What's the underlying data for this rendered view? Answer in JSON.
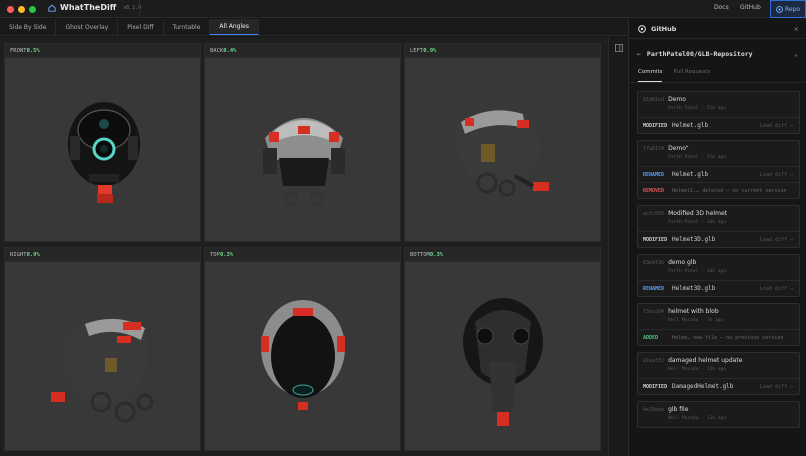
{
  "window": {
    "traffic_lights": [
      "#ff5f57",
      "#febc2e",
      "#28c840"
    ]
  },
  "app": {
    "title": "WhatTheDiff",
    "version": "v0.1.0"
  },
  "top_nav": {
    "docs": "Docs",
    "github": "GitHub",
    "repo_button": "Repo"
  },
  "view_tabs": [
    {
      "label": "Side By Side"
    },
    {
      "label": "Ghost Overlay"
    },
    {
      "label": "Pixel Diff"
    },
    {
      "label": "Turntable"
    },
    {
      "label": "All Angles",
      "active": true
    }
  ],
  "views": [
    {
      "label": "FRONT",
      "pct": "0.5%"
    },
    {
      "label": "BACK",
      "pct": "0.4%"
    },
    {
      "label": "LEFT",
      "pct": "0.9%"
    },
    {
      "label": "RIGHT",
      "pct": "0.9%"
    },
    {
      "label": "TOP",
      "pct": "0.3%"
    },
    {
      "label": "BOTTOM",
      "pct": "0.3%"
    }
  ],
  "panel": {
    "title": "GitHub",
    "close": "×",
    "repo": "ParthPatel00/GLB-Repository",
    "tabs": [
      "Commits",
      "Pull Requests"
    ],
    "commits": [
      {
        "sha": "81d01bd",
        "message": "Demo",
        "meta": "Parth Patel · 51m ago",
        "files": [
          {
            "status": "MODIFIED",
            "name": "Helmet.glb",
            "action": "Load diff →"
          }
        ]
      },
      {
        "sha": "f7a8174",
        "message": "Demo\"",
        "meta": "Parth Patel · 52m ago",
        "files": [
          {
            "status": "RENAMED",
            "name": "Helmet.glb",
            "action": "Load diff →"
          },
          {
            "status": "REMOVED",
            "name": "Helmet1.… deleted — no current version",
            "dim": true
          }
        ]
      },
      {
        "sha": "acfc505",
        "message": "Modified 3D helmet",
        "meta": "Parth Patel · 10h ago",
        "files": [
          {
            "status": "MODIFIED",
            "name": "Helmet3D.glb",
            "action": "Load diff →"
          }
        ]
      },
      {
        "sha": "63e9f2b",
        "message": "demo glb",
        "meta": "Parth Patel · 10h ago",
        "files": [
          {
            "status": "RENAMED",
            "name": "Helmet3D.glb",
            "action": "Load diff →"
          }
        ]
      },
      {
        "sha": "73ecd04",
        "message": "helmet with blob",
        "meta": "Neil Mosada · 1h ago",
        "files": [
          {
            "status": "ADDED",
            "name": "Helme… new file — no previous version",
            "dim": true
          }
        ]
      },
      {
        "sha": "a1ea3f2",
        "message": "damaged helmet update",
        "meta": "Neil Mosada · 13h ago",
        "files": [
          {
            "status": "MODIFIED",
            "name": "DamagedHelmet.glb",
            "action": "Load diff →"
          }
        ]
      },
      {
        "sha": "4e29ada",
        "message": "glb file",
        "meta": "Neil Mosada · 13h ago",
        "files": []
      }
    ]
  },
  "status_colors": {
    "MODIFIED": "#cfcfcf",
    "RENAMED": "#5b9cf5",
    "REMOVED": "#e05252",
    "ADDED": "#4cc47a"
  },
  "icons": [
    "home-icon",
    "github-icon",
    "collapse-panel-icon",
    "back-arrow-icon",
    "chevron-down-icon"
  ]
}
